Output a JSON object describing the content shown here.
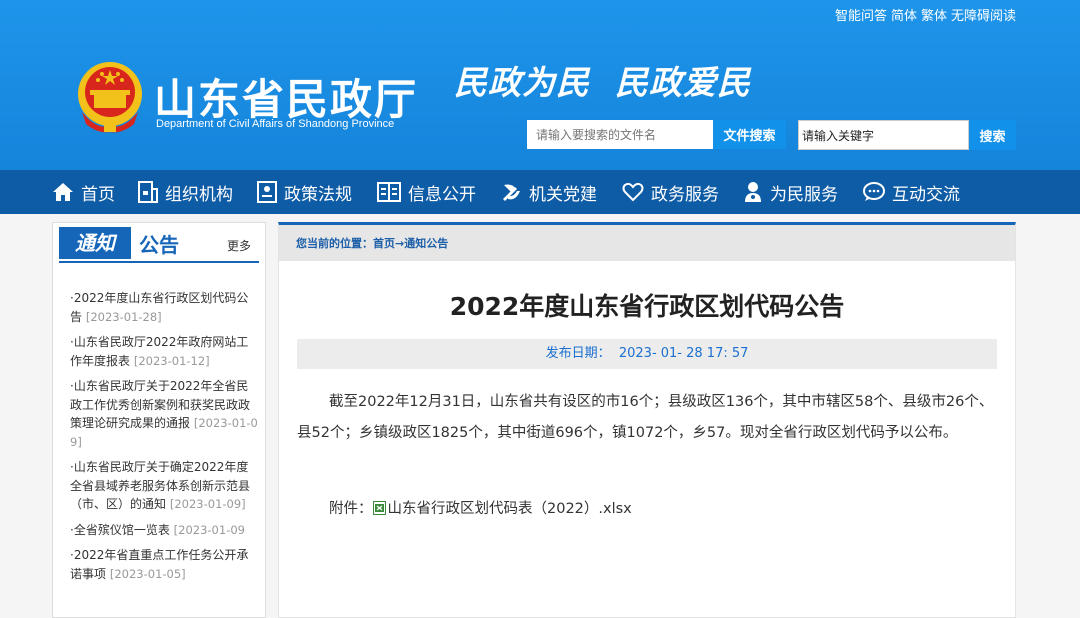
{
  "header": {
    "top_links": [
      "智能问答",
      "简体",
      "繁体",
      "无障碍阅读"
    ],
    "site_title": "山东省民政厅",
    "site_subtitle": "Department of Civil Affairs of Shandong Province",
    "slogan": "民政为民  民政爱民",
    "search_file_placeholder": "请输入要搜索的文件名",
    "search_file_button": "文件搜索",
    "search_keyword_value": "请输入关键字",
    "search_keyword_button": "搜索"
  },
  "nav": {
    "items": [
      {
        "label": "首页",
        "icon": "home-icon"
      },
      {
        "label": "组织机构",
        "icon": "org-icon"
      },
      {
        "label": "政策法规",
        "icon": "policy-icon"
      },
      {
        "label": "信息公开",
        "icon": "book-icon"
      },
      {
        "label": "机关党建",
        "icon": "party-icon"
      },
      {
        "label": "政务服务",
        "icon": "heart-icon"
      },
      {
        "label": "为民服务",
        "icon": "person-icon"
      },
      {
        "label": "互动交流",
        "icon": "chat-icon"
      }
    ]
  },
  "sidebar": {
    "badge": "通知",
    "title": "公告",
    "more": "更多",
    "items": [
      {
        "text": "·2022年度山东省行政区划代码公告",
        "date": "[2023-01-28]"
      },
      {
        "text": "·山东省民政厅2022年政府网站工作年度报表",
        "date": "[2023-01-12]"
      },
      {
        "text": "·山东省民政厅关于2022年全省民政工作优秀创新案例和获奖民政政策理论研究成果的通报",
        "date": "[2023-01-09]"
      },
      {
        "text": "·山东省民政厅关于确定2022年度全省县域养老服务体系创新示范县（市、区）的通知",
        "date": "[2023-01-09]"
      },
      {
        "text": "·全省殡仪馆一览表",
        "date": "[2023-01-09"
      },
      {
        "text": "·2022年省直重点工作任务公开承诺事项",
        "date": "[2023-01-05]"
      }
    ]
  },
  "main": {
    "breadcrumb": "您当前的位置：首页→通知公告",
    "title": "2022年度山东省行政区划代码公告",
    "publish_date": "发布日期：  2023- 01- 28 17: 57",
    "body": "截至2022年12月31日，山东省共有设区的市16个；县级政区136个，其中市辖区58个、县级市26个、县52个；乡镇级政区1825个，其中街道696个，镇1072个，乡57。现对全省行政区划代码予以公布。",
    "attachment_label": "附件：",
    "attachment_name": "山东省行政区划代码表（2022）.xlsx"
  },
  "colors": {
    "header_blue": "#1a8de3",
    "nav_blue": "#0f5ca6",
    "accent_blue": "#1565b8",
    "emblem_red": "#d9261c",
    "emblem_gold": "#f3c21a"
  }
}
